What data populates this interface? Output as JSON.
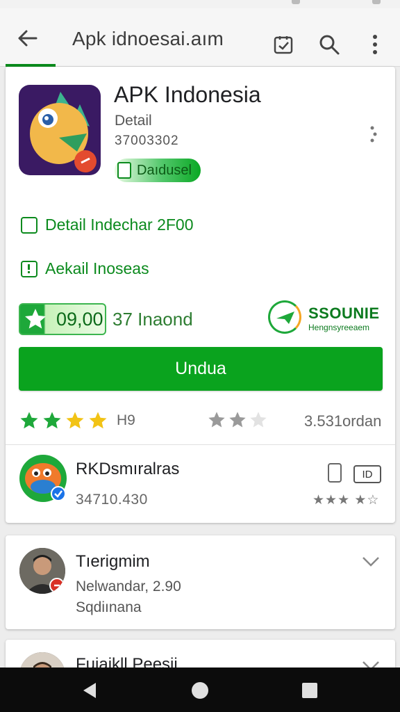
{
  "toolbar": {
    "title": "Apk idnoesai.aım",
    "back_icon": "arrow-back-icon",
    "icons": [
      "shield-check-icon",
      "search-icon",
      "more-vert-icon"
    ]
  },
  "app": {
    "name": "APK Indonesia",
    "subtitle": "Detail",
    "code": "37003302",
    "installed_label": "Daıdusel"
  },
  "details": {
    "row1": "Detail Indechar 2F00",
    "row2": "Aekail Inoseas"
  },
  "rating": {
    "value": "09,00",
    "text": "37 Inaond",
    "badge_title": "SSOUNIE",
    "badge_subtitle": "Hengnsyreeaem",
    "stars_left_label": "H9",
    "downloads": "3.531ordan",
    "stars_left_filled": 4,
    "stars_mid_filled": 2,
    "stars_mid_total": 3
  },
  "install_button": {
    "label": "Undua"
  },
  "developer": {
    "name": "RKDsmıralras",
    "number": "34710.430",
    "tag": "ID",
    "stars_text": "★★★ ★☆"
  },
  "reviews": [
    {
      "name": "Tıerigmim",
      "line1": "Nelwandar, 2.90",
      "line2": "Sqdiınana"
    },
    {
      "name": "Fujajkll Peesji"
    }
  ],
  "colors": {
    "accent": "#0aa31e",
    "accent_dark": "#0b8a1d",
    "star_green": "#1ea83a",
    "star_yellow": "#f2c315",
    "navbar": "#0c0c0c"
  },
  "navbar": {
    "icons": [
      "back-triangle-icon",
      "home-circle-icon",
      "recents-square-icon"
    ]
  }
}
